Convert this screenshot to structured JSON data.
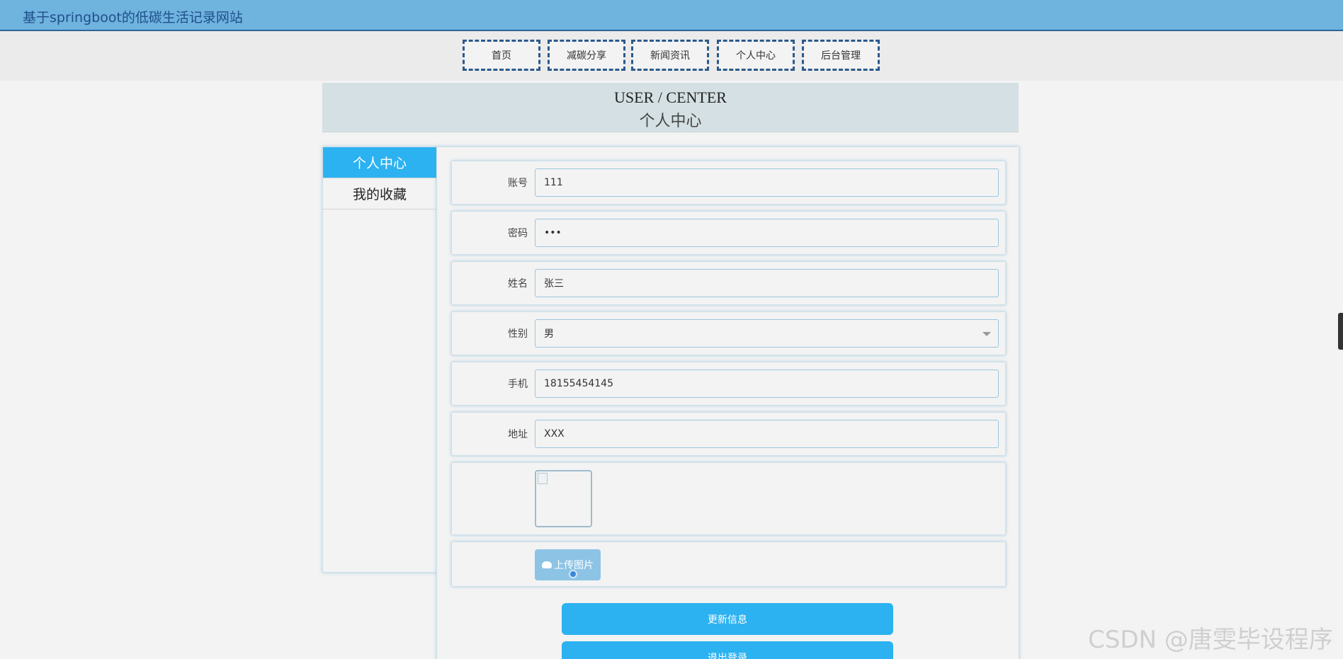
{
  "header": {
    "site_title": "基于springboot的低碳生活记录网站"
  },
  "nav": {
    "items": [
      {
        "label": "首页"
      },
      {
        "label": "减碳分享"
      },
      {
        "label": "新闻资讯"
      },
      {
        "label": "个人中心"
      },
      {
        "label": "后台管理"
      }
    ]
  },
  "banner": {
    "title_en": "USER / CENTER",
    "title_cn": "个人中心"
  },
  "sidebar": {
    "items": [
      {
        "label": "个人中心",
        "active": true
      },
      {
        "label": "我的收藏",
        "active": false
      }
    ]
  },
  "form": {
    "account": {
      "label": "账号",
      "value": "111"
    },
    "password": {
      "label": "密码",
      "value": "•••"
    },
    "name": {
      "label": "姓名",
      "value": "张三"
    },
    "gender": {
      "label": "性别",
      "value": "男"
    },
    "phone": {
      "label": "手机",
      "value": "18155454145"
    },
    "address": {
      "label": "地址",
      "value": "XXX"
    },
    "upload_label": "上传图片",
    "update_button": "更新信息",
    "logout_button": "退出登录"
  },
  "watermark": "CSDN @唐雯毕设程序",
  "colors": {
    "topbar": "#6fb3df",
    "accent": "#2cb2f0",
    "nav_border": "#2c5a8c",
    "banner": "#d4e0e3"
  },
  "icons": {
    "upload": "cloud-upload-icon",
    "select_arrow": "chevron-down-icon"
  }
}
